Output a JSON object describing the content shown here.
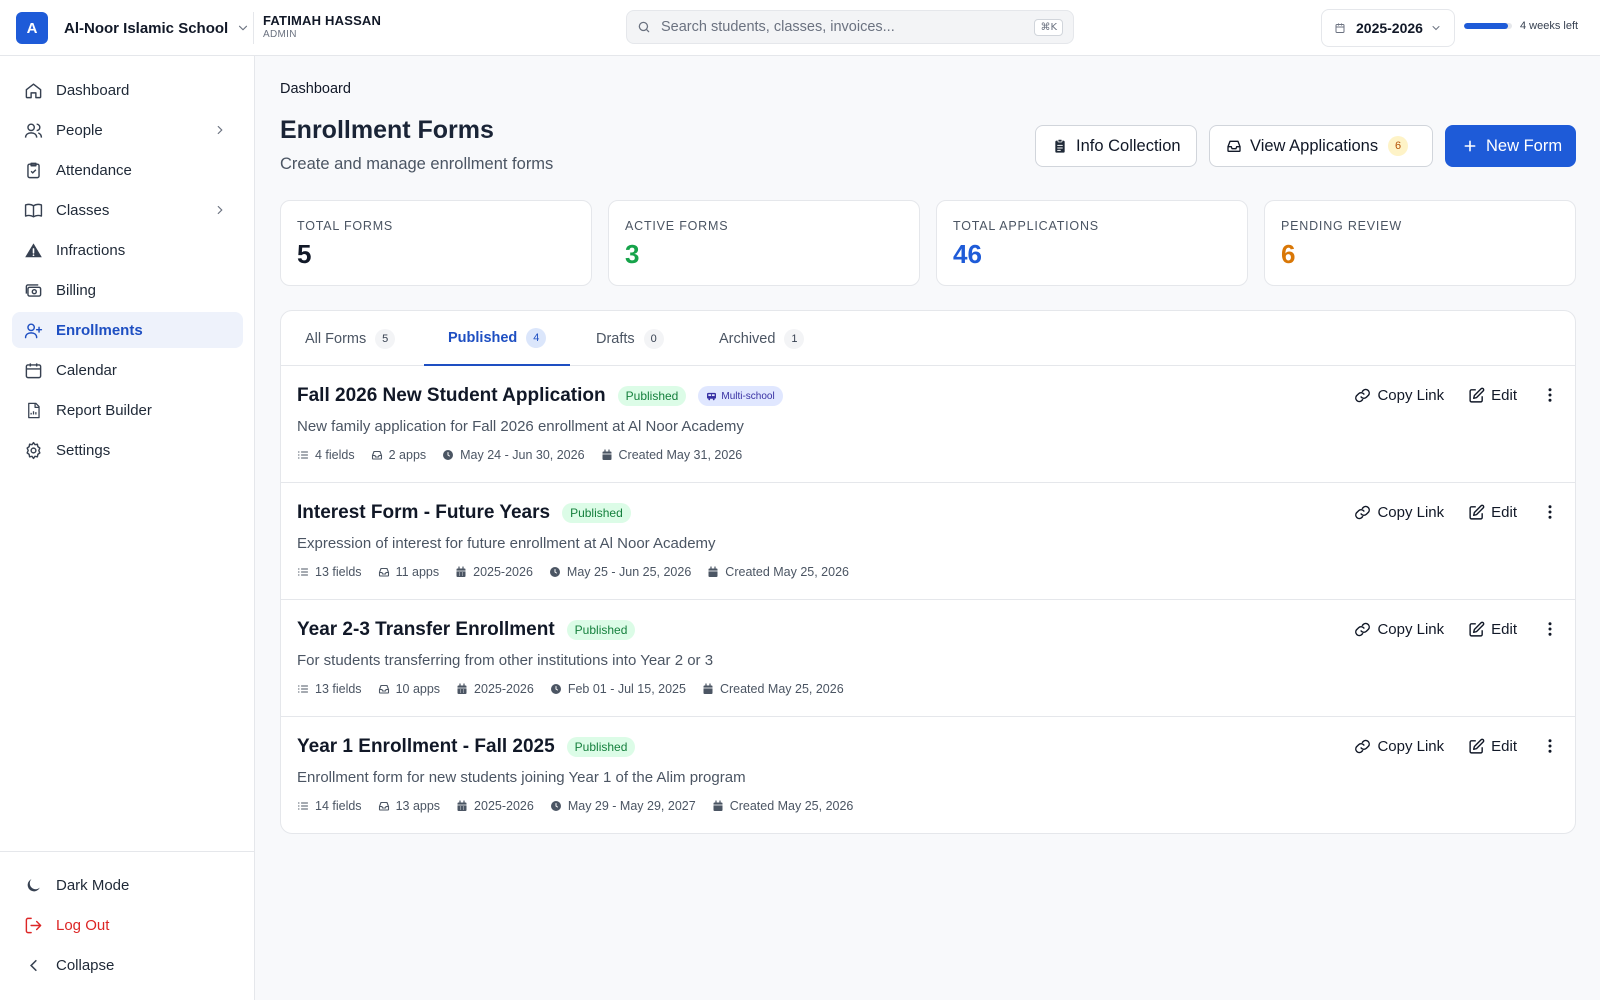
{
  "topbar": {
    "school_initial": "A",
    "school_name": "Al-Noor Islamic School",
    "user_name": "FATIMAH HASSAN",
    "user_role": "ADMIN",
    "search_placeholder": "Search students, classes, invoices...",
    "search_shortcut": "⌘K",
    "academic_year": "2025-2026",
    "term_progress": 0.92,
    "term_remaining": "4 weeks left"
  },
  "sidebar": {
    "items": [
      {
        "label": "Dashboard",
        "icon": "home-icon"
      },
      {
        "label": "People",
        "icon": "users-icon",
        "expandable": true
      },
      {
        "label": "Attendance",
        "icon": "clipboard-check-icon"
      },
      {
        "label": "Classes",
        "icon": "book-icon",
        "expandable": true
      },
      {
        "label": "Infractions",
        "icon": "warning-triangle-icon"
      },
      {
        "label": "Billing",
        "icon": "money-icon"
      },
      {
        "label": "Enrollments",
        "icon": "user-plus-icon",
        "active": true
      },
      {
        "label": "Calendar",
        "icon": "calendar-icon"
      },
      {
        "label": "Report Builder",
        "icon": "report-icon"
      },
      {
        "label": "Settings",
        "icon": "gear-icon"
      }
    ],
    "bottom": {
      "dark_mode": "Dark Mode",
      "logout": "Log Out",
      "collapse": "Collapse"
    }
  },
  "main": {
    "breadcrumb": "Dashboard",
    "title": "Enrollment Forms",
    "subtitle": "Create and manage enrollment forms",
    "buttons": {
      "info_collection": "Info Collection",
      "view_applications": "View Applications",
      "view_applications_count": "6",
      "new_form": "New Form"
    },
    "stats": [
      {
        "label": "TOTAL FORMS",
        "value": "5",
        "color": "#111827"
      },
      {
        "label": "ACTIVE FORMS",
        "value": "3",
        "color": "#16a34a"
      },
      {
        "label": "TOTAL APPLICATIONS",
        "value": "46",
        "color": "#1e5bd8"
      },
      {
        "label": "PENDING REVIEW",
        "value": "6",
        "color": "#d97706"
      }
    ],
    "tabs": [
      {
        "label": "All Forms",
        "count": "5"
      },
      {
        "label": "Published",
        "count": "4",
        "active": true
      },
      {
        "label": "Drafts",
        "count": "0"
      },
      {
        "label": "Archived",
        "count": "1"
      }
    ],
    "actions": {
      "copy_link": "Copy Link",
      "edit": "Edit"
    },
    "forms": [
      {
        "title": "Fall 2026 New Student Application",
        "status": "Published",
        "tag": "Multi-school",
        "description": "New family application for Fall 2026 enrollment at Al Noor Academy",
        "fields": "4 fields",
        "apps": "2 apps",
        "year": "",
        "dates": "May 24 - Jun 30, 2026",
        "created": "Created May 31, 2026"
      },
      {
        "title": "Interest Form - Future Years",
        "status": "Published",
        "description": "Expression of interest for future enrollment at Al Noor Academy",
        "fields": "13 fields",
        "apps": "11 apps",
        "year": "2025-2026",
        "dates": "May 25 - Jun 25, 2026",
        "created": "Created May 25, 2026"
      },
      {
        "title": "Year 2-3 Transfer Enrollment",
        "status": "Published",
        "description": "For students transferring from other institutions into Year 2 or 3",
        "fields": "13 fields",
        "apps": "10 apps",
        "year": "2025-2026",
        "dates": "Feb 01 - Jul 15, 2025",
        "created": "Created May 25, 2026"
      },
      {
        "title": "Year 1 Enrollment - Fall 2025",
        "status": "Published",
        "description": "Enrollment form for new students joining Year 1 of the Alim program",
        "fields": "14 fields",
        "apps": "13 apps",
        "year": "2025-2026",
        "dates": "May 29 - May 29, 2027",
        "created": "Created May 25, 2026"
      }
    ]
  }
}
